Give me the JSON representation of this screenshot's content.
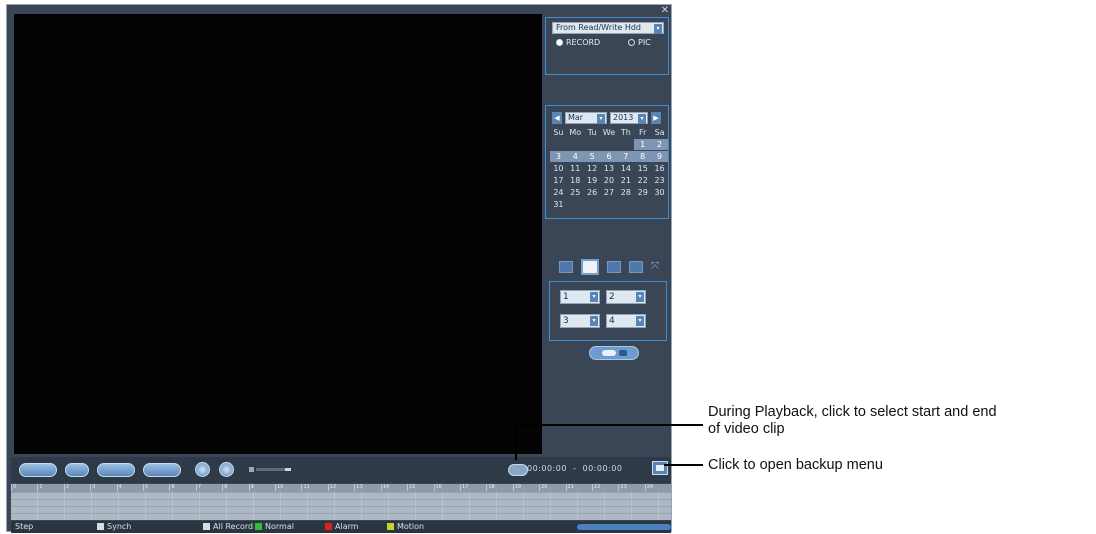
{
  "source": {
    "selected": "From Read/Write Hdd",
    "modes": [
      {
        "label": "RECORD",
        "selected": true
      },
      {
        "label": "PIC",
        "selected": false
      }
    ]
  },
  "calendar": {
    "month": "Mar",
    "year": "2013",
    "weekdays": [
      "Su",
      "Mo",
      "Tu",
      "We",
      "Th",
      "Fr",
      "Sa"
    ],
    "weeks": [
      [
        "",
        "",
        "",
        "",
        "",
        "1",
        "2"
      ],
      [
        "3",
        "4",
        "5",
        "6",
        "7",
        "8",
        "9"
      ],
      [
        "10",
        "11",
        "12",
        "13",
        "14",
        "15",
        "16"
      ],
      [
        "17",
        "18",
        "19",
        "20",
        "21",
        "22",
        "23"
      ],
      [
        "24",
        "25",
        "26",
        "27",
        "28",
        "29",
        "30"
      ],
      [
        "31",
        "",
        "",
        "",
        "",
        "",
        ""
      ]
    ],
    "highlighted_days": [
      "1",
      "2",
      "3",
      "4",
      "5",
      "6",
      "7",
      "8",
      "9"
    ]
  },
  "channels": [
    "1",
    "2",
    "3",
    "4"
  ],
  "playback": {
    "clip_start": "00:00:00",
    "clip_end": "00:00:00"
  },
  "timeline": {
    "hours": [
      "0",
      "1",
      "2",
      "3",
      "4",
      "5",
      "6",
      "7",
      "8",
      "9",
      "10",
      "11",
      "12",
      "13",
      "14",
      "15",
      "16",
      "17",
      "18",
      "19",
      "20",
      "21",
      "22",
      "23",
      "24"
    ]
  },
  "legend": {
    "step": "Step",
    "synch": "Synch",
    "items": [
      {
        "label": "All Record",
        "color": "#d8dde2"
      },
      {
        "label": "Normal",
        "color": "#2fbf3a"
      },
      {
        "label": "Alarm",
        "color": "#e02020"
      },
      {
        "label": "Motion",
        "color": "#c9d22a"
      }
    ]
  },
  "callouts": {
    "clip": "During Playback, click to select start and end\nof video clip",
    "backup": "Click to open backup menu"
  }
}
